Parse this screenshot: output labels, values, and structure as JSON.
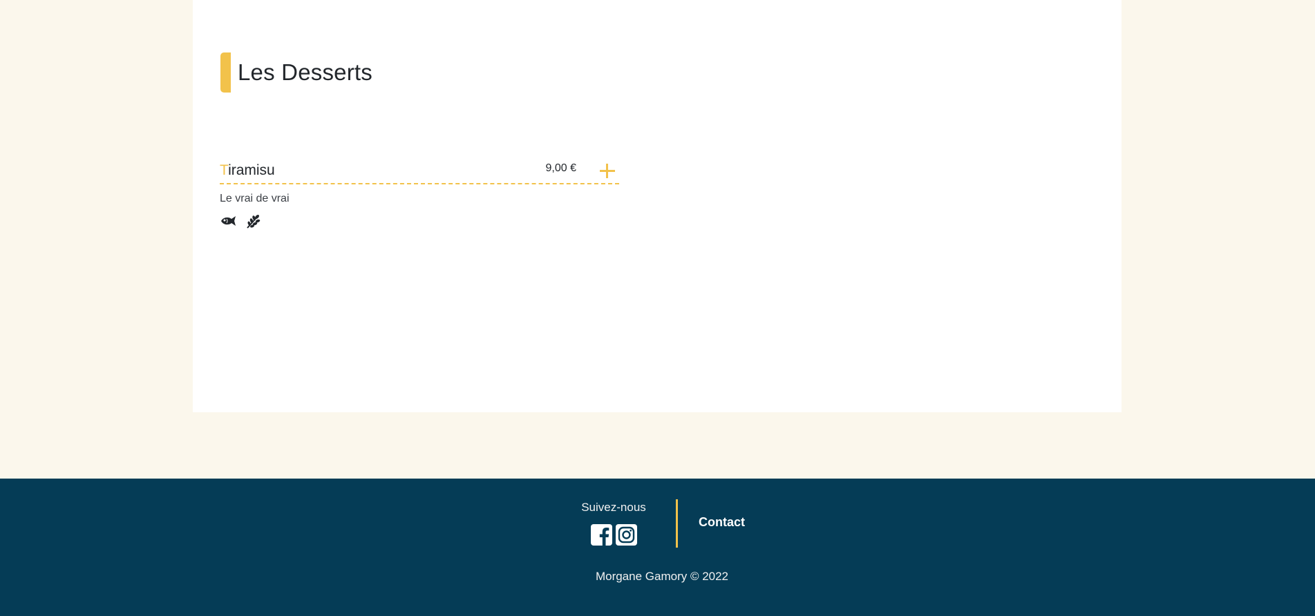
{
  "section": {
    "title": "Les Desserts"
  },
  "dishes": [
    {
      "name_initial": "T",
      "name_rest": "iramisu",
      "price": "9,00 €",
      "description": "Le vrai de vrai",
      "allergens": [
        "fish-icon",
        "wheat-icon"
      ]
    }
  ],
  "footer": {
    "follow_label": "Suivez-nous",
    "socials": [
      "facebook-icon",
      "instagram-icon"
    ],
    "contact_label": "Contact",
    "copyright": "Morgane Gamory © 2022"
  },
  "colors": {
    "accent": "#f2c24b",
    "footer_bg": "#053c56",
    "page_bg": "#fbf7ec",
    "card_bg": "#ffffff",
    "text": "#22262b"
  }
}
